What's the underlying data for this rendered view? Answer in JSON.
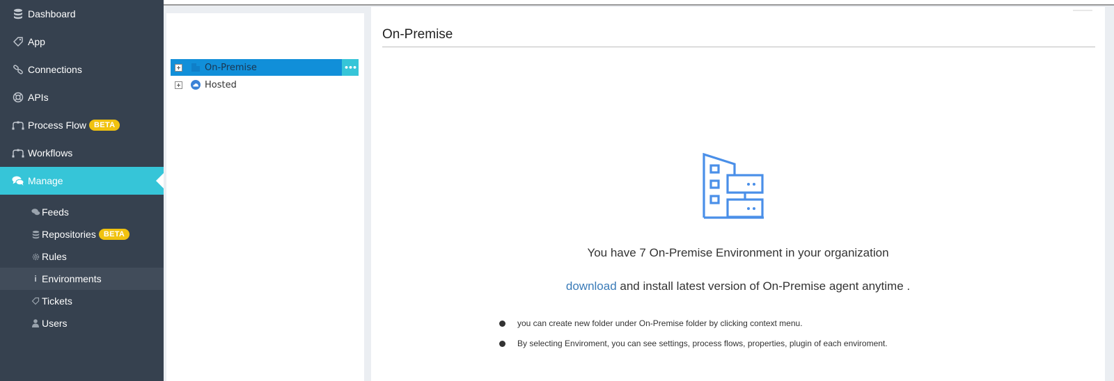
{
  "sidebar": {
    "items": [
      {
        "label": "Dashboard",
        "icon": "database-icon"
      },
      {
        "label": "App",
        "icon": "tag-icon"
      },
      {
        "label": "Connections",
        "icon": "link-icon"
      },
      {
        "label": "APIs",
        "icon": "life-ring-icon"
      },
      {
        "label": "Process Flow",
        "icon": "flow-icon",
        "badge": "BETA"
      },
      {
        "label": "Workflows",
        "icon": "flow-icon"
      },
      {
        "label": "Manage",
        "icon": "comments-icon",
        "active": true
      }
    ],
    "sub_items": [
      {
        "label": "Feeds",
        "icon": "comments-icon"
      },
      {
        "label": "Repositories",
        "icon": "database-icon",
        "badge": "BETA"
      },
      {
        "label": "Rules",
        "icon": "gear-icon"
      },
      {
        "label": "Environments",
        "icon": "info-icon",
        "selected": true
      },
      {
        "label": "Tickets",
        "icon": "tag-icon"
      },
      {
        "label": "Users",
        "icon": "user-icon"
      }
    ]
  },
  "tree": {
    "nodes": [
      {
        "label": "On-Premise",
        "icon": "building-icon",
        "selected": true,
        "more": "•••"
      },
      {
        "label": "Hosted",
        "icon": "cloud-icon"
      }
    ]
  },
  "main": {
    "title": "On-Premise",
    "count_text": "You have 7 On-Premise Environment in your organization",
    "download_link": "download",
    "download_rest": " and install latest version of On-Premise agent anytime .",
    "tips": [
      "you can create new folder under On-Premise folder by clicking context menu.",
      "By selecting Enviroment, you can see settings, process flows, properties, plugin of each enviroment."
    ]
  },
  "colors": {
    "sidebar_bg": "#36414f",
    "active_accent": "#36c5d8",
    "badge": "#f0c20f",
    "tree_selected": "#118fd9",
    "link": "#3a7bb8",
    "hero_icon": "#4a8fe8"
  }
}
